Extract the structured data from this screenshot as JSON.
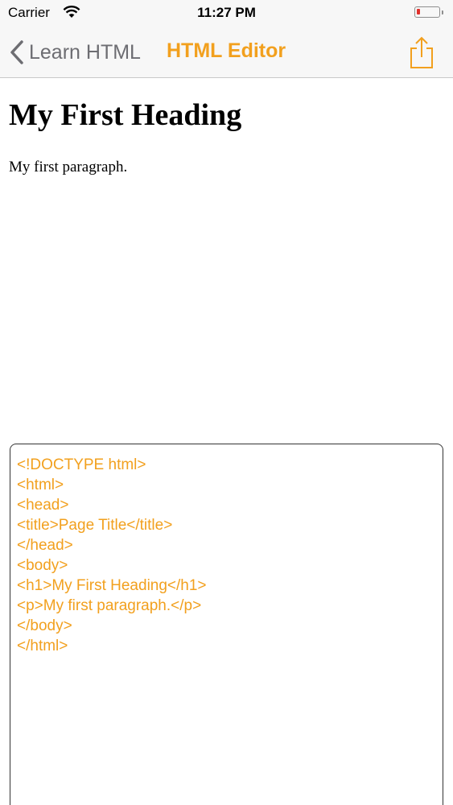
{
  "status_bar": {
    "carrier": "Carrier",
    "time": "11:27 PM",
    "battery_color": "#e0302b"
  },
  "nav": {
    "back_label": "Learn HTML",
    "title": "HTML Editor",
    "share_icon": "share-icon",
    "accent_color": "#f2a01e"
  },
  "preview": {
    "heading": "My First Heading",
    "paragraph": "My first paragraph."
  },
  "editor": {
    "lines": [
      "<!DOCTYPE html>",
      "<html>",
      "<head>",
      "<title>Page Title</title>",
      "</head>",
      "<body>",
      "<h1>My First Heading</h1>",
      "<p>My first paragraph.</p>",
      "</body>",
      "</html>"
    ]
  }
}
